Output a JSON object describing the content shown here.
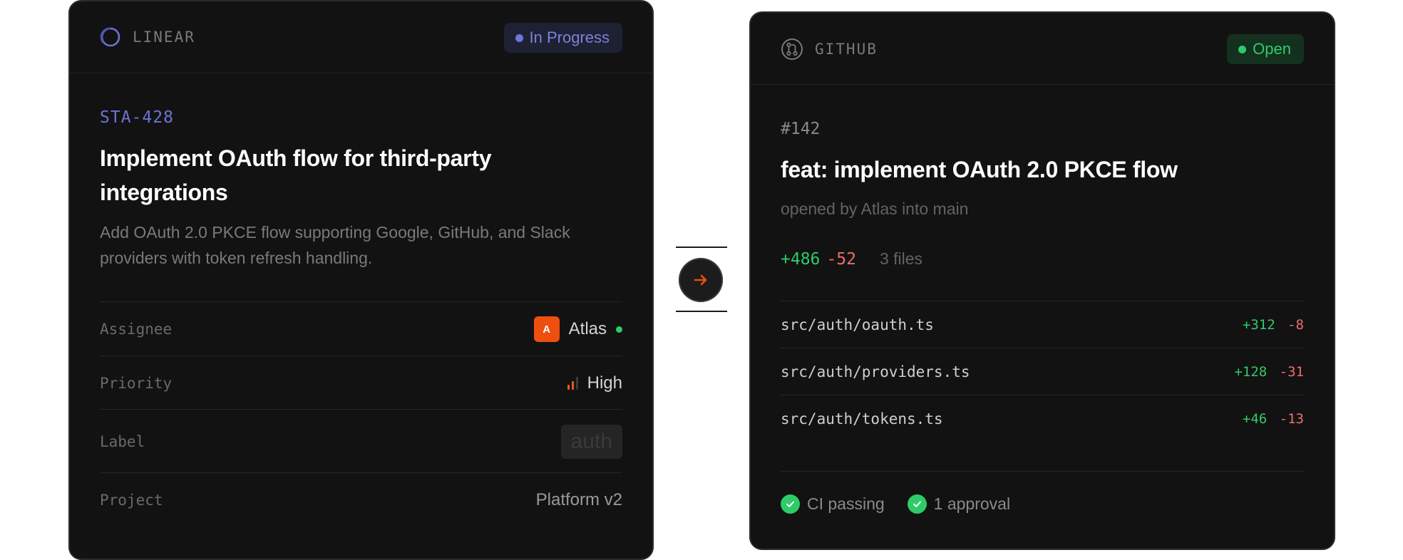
{
  "linear": {
    "brand": "LINEAR",
    "status": "In Progress",
    "issue_id": "STA-428",
    "title": "Implement OAuth flow for third-party integrations",
    "description": "Add OAuth 2.0 PKCE flow supporting Google, GitHub, and Slack providers with token refresh handling.",
    "properties": {
      "assignee": {
        "key": "Assignee",
        "avatar": "A",
        "value": "Atlas"
      },
      "priority": {
        "key": "Priority",
        "value": "High",
        "icon": "signal-bars-icon"
      },
      "label": {
        "key": "Label",
        "value": "auth"
      },
      "project": {
        "key": "Project",
        "value": "Platform v2"
      }
    }
  },
  "connector": {
    "icon": "arrow-right-icon"
  },
  "github": {
    "brand": "GITHUB",
    "status": "Open",
    "pr_number": "#142",
    "title": "feat: implement OAuth 2.0 PKCE flow",
    "subtitle": "opened by Atlas into main",
    "additions": "+486",
    "deletions": "-52",
    "files_count": "3 files",
    "files": [
      {
        "path": "src/auth/oauth.ts",
        "additions": "+312",
        "deletions": "-8"
      },
      {
        "path": "src/auth/providers.ts",
        "additions": "+128",
        "deletions": "-31"
      },
      {
        "path": "src/auth/tokens.ts",
        "additions": "+46",
        "deletions": "-13"
      }
    ],
    "checks": [
      {
        "label": "CI passing"
      },
      {
        "label": "1 approval"
      }
    ]
  },
  "colors": {
    "card_bg": "#121212",
    "linear_accent": "#6d74d4",
    "github_open": "#2fcb68",
    "deletion": "#ec6d6d",
    "orange": "#ee4f0e"
  }
}
